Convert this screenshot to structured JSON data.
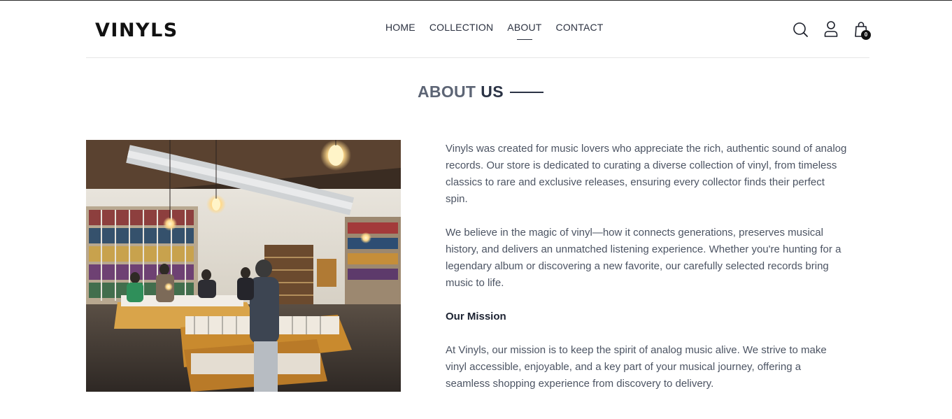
{
  "brand": {
    "logo": "VINYLS"
  },
  "nav": {
    "items": [
      {
        "label": "HOME"
      },
      {
        "label": "COLLECTION"
      },
      {
        "label": "ABOUT",
        "active": true
      },
      {
        "label": "CONTACT"
      }
    ]
  },
  "header_icons": {
    "search": "search-icon",
    "account": "user-icon",
    "cart": "shopping-bag-icon",
    "cart_count": "0"
  },
  "about": {
    "title_light": "ABOUT",
    "title_strong": "US",
    "paragraph1": "Vinyls was created for music lovers who appreciate the rich, authentic sound of analog records. Our store is dedicated to curating a diverse collection of vinyl, from timeless classics to rare and exclusive releases, ensuring every collector finds their perfect spin.",
    "paragraph2": "We believe in the magic of vinyl—how it connects generations, preserves musical history, and delivers an unmatched listening experience. Whether you're hunting for a legendary album or discovering a new favorite, our carefully selected records bring music to life.",
    "mission_heading": "Our Mission",
    "mission_text": "At Vinyls, our mission is to keep the spirit of analog music alive. We strive to make vinyl accessible, enjoyable, and a key part of your musical journey, offering a seamless shopping experience from discovery to delivery."
  },
  "colors": {
    "text_dark": "#2b3140",
    "text_body": "#4c5463",
    "divider": "#e6e6e6",
    "badge": "#111111"
  }
}
